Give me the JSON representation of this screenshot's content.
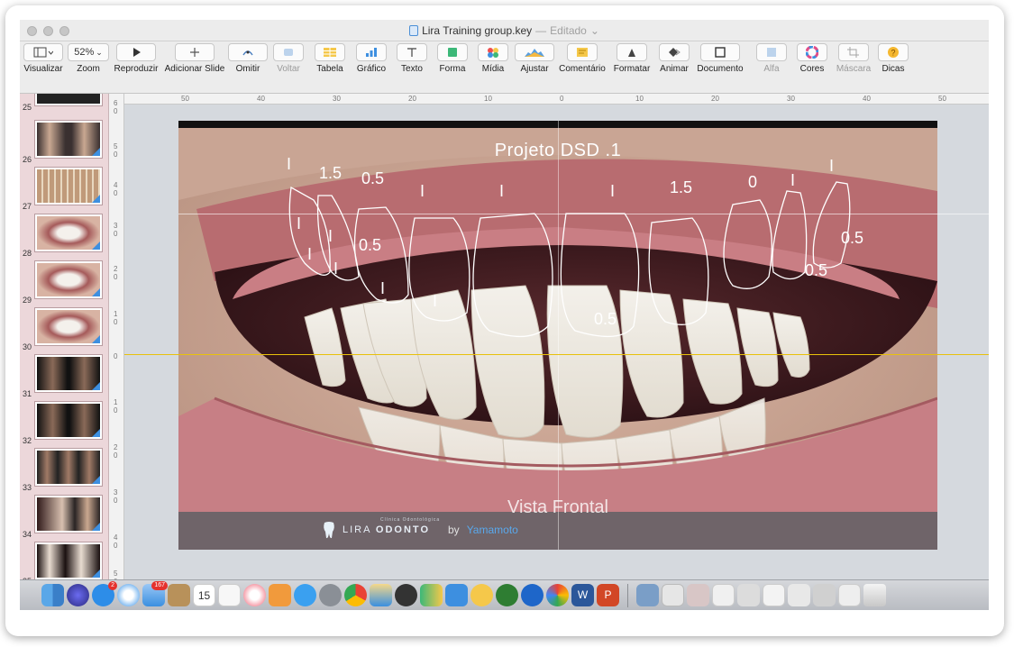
{
  "window": {
    "file_name": "Lira Training group.key",
    "separator": "—",
    "status": "Editado"
  },
  "toolbar": {
    "items": [
      {
        "label": "Visualizar",
        "icon": "sidebar-view-icon"
      },
      {
        "label": "Zoom",
        "value": "52%",
        "icon": "zoom-dropdown-icon"
      },
      {
        "label": "Reproduzir",
        "icon": "play-icon"
      },
      {
        "label": "Adicionar Slide",
        "icon": "plus-icon"
      },
      {
        "label": "Omitir",
        "icon": "skip-icon"
      },
      {
        "label": "Voltar",
        "icon": "back-icon",
        "disabled": true
      },
      {
        "label": "Tabela",
        "icon": "table-icon"
      },
      {
        "label": "Gráfico",
        "icon": "chart-icon"
      },
      {
        "label": "Texto",
        "icon": "text-icon"
      },
      {
        "label": "Forma",
        "icon": "shape-icon"
      },
      {
        "label": "Mídia",
        "icon": "media-icon"
      },
      {
        "label": "Ajustar",
        "icon": "adjust-icon"
      },
      {
        "label": "Comentário",
        "icon": "comment-icon"
      },
      {
        "label": "Formatar",
        "icon": "format-icon"
      },
      {
        "label": "Animar",
        "icon": "animate-icon"
      },
      {
        "label": "Documento",
        "icon": "document-icon"
      },
      {
        "label": "Alfa",
        "icon": "alpha-icon",
        "disabled": true
      },
      {
        "label": "Cores",
        "icon": "colors-icon"
      },
      {
        "label": "Máscara",
        "icon": "mask-icon",
        "disabled": true
      },
      {
        "label": "Dicas",
        "icon": "tips-icon"
      }
    ]
  },
  "ruler": {
    "horizontal": [
      "50",
      "40",
      "30",
      "20",
      "10",
      "0",
      "10",
      "20",
      "30",
      "40",
      "50"
    ],
    "vertical": [
      "6 0",
      "5 0",
      "4 0",
      "3 0",
      "2 0",
      "1 0",
      "0",
      "1 0",
      "2 0",
      "3 0",
      "4 0",
      "5 0"
    ]
  },
  "slides": {
    "numbers": [
      "25",
      "26",
      "27",
      "28",
      "29",
      "30",
      "31",
      "32",
      "33",
      "34",
      "35"
    ]
  },
  "current_slide": {
    "title": "Projeto DSD .1",
    "caption": "Vista Frontal",
    "measurements": [
      "I",
      "1.5",
      "0.5",
      "I",
      "I",
      "I",
      "1.5",
      "0",
      "I",
      "I",
      "I",
      "I",
      "0.5",
      "I",
      "I",
      "I",
      "I",
      "0.5",
      "0.5",
      "0.5"
    ],
    "footer": {
      "brand_sub": "Clínica Odontológica",
      "brand_light": "LIRA",
      "brand_bold": "ODONTO",
      "by": "by",
      "author": "Yamamoto"
    }
  },
  "dock": {
    "badges": {
      "mail": "2",
      "calendar_day": "15",
      "calendar_badge": "167"
    }
  },
  "colors": {
    "guide": "#e8c10b",
    "sidebar_bg": "#ecd7da",
    "author_link": "#59a8ec"
  }
}
